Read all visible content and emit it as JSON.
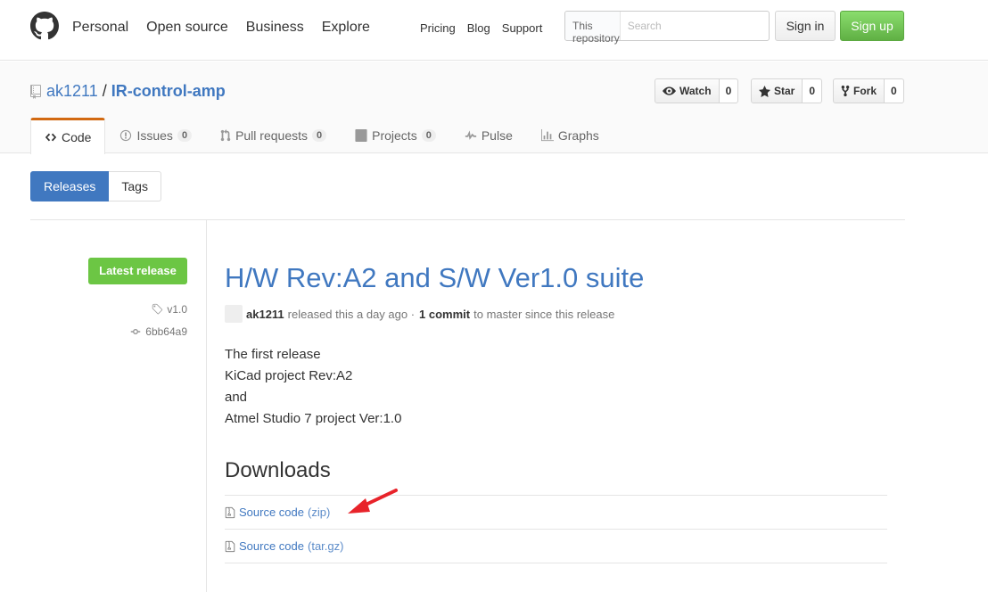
{
  "header": {
    "nav": [
      "Personal",
      "Open source",
      "Business",
      "Explore"
    ],
    "subnav": [
      "Pricing",
      "Blog",
      "Support"
    ],
    "search_scope": "This repository",
    "search_placeholder": "Search",
    "signin_label": "Sign in",
    "signup_label": "Sign up"
  },
  "repo": {
    "owner": "ak1211",
    "separator": "/",
    "name": "IR-control-amp",
    "watch_label": "Watch",
    "watch_count": "0",
    "star_label": "Star",
    "star_count": "0",
    "fork_label": "Fork",
    "fork_count": "0"
  },
  "tabs": [
    {
      "label": "Code",
      "count": null,
      "selected": true
    },
    {
      "label": "Issues",
      "count": "0"
    },
    {
      "label": "Pull requests",
      "count": "0"
    },
    {
      "label": "Projects",
      "count": "0"
    },
    {
      "label": "Pulse",
      "count": null
    },
    {
      "label": "Graphs",
      "count": null
    }
  ],
  "release_nav": {
    "releases": "Releases",
    "tags": "Tags"
  },
  "release": {
    "badge": "Latest release",
    "tag": "v1.0",
    "commit": "6bb64a9",
    "title": "H/W Rev:A2 and S/W Ver1.0 suite",
    "author": "ak1211",
    "released_text": "released this a day ago ·",
    "commits": "1 commit",
    "commits_suffix": "to master since this release",
    "body": [
      "The first release",
      "KiCad project Rev:A2",
      "and",
      "Atmel Studio 7 project Ver:1.0"
    ]
  },
  "downloads": {
    "heading": "Downloads",
    "items": [
      {
        "label": "Source code",
        "ext": "(zip)"
      },
      {
        "label": "Source code",
        "ext": "(tar.gz)"
      }
    ]
  },
  "colors": {
    "accent": "#4078c0",
    "green": "#6cc644",
    "tab_accent": "#d26911",
    "arrow": "#e8232a"
  }
}
